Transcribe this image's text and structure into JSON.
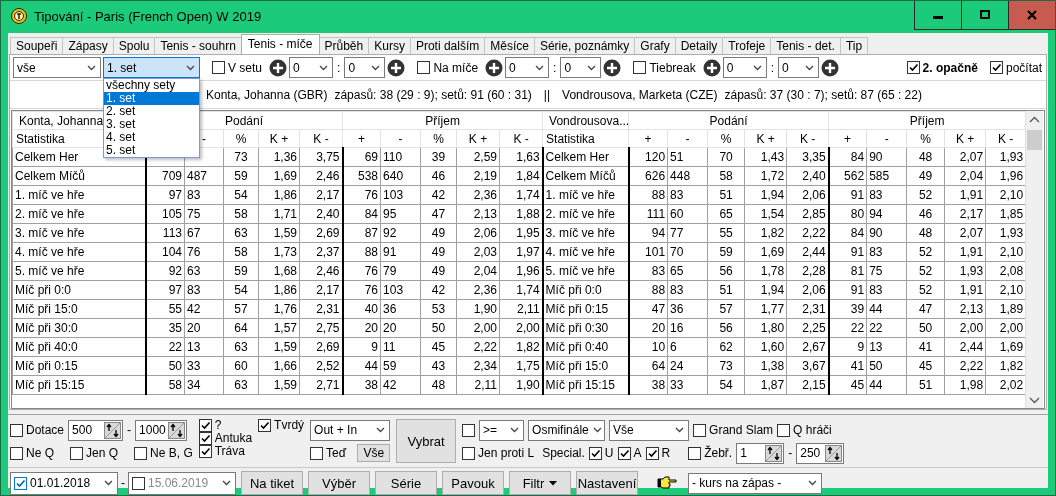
{
  "window": {
    "title": "Tipování - Paris (French Open) W 2019"
  },
  "tabs": [
    {
      "label": "Soupeři",
      "selected": false
    },
    {
      "label": "Zápasy",
      "selected": false
    },
    {
      "label": "Spolu",
      "selected": false
    },
    {
      "label": "Tenis - souhrn",
      "selected": false
    },
    {
      "label": "Tenis - míče",
      "selected": true
    },
    {
      "label": "Průběh",
      "selected": false
    },
    {
      "label": "Kursy",
      "selected": false
    },
    {
      "label": "Proti dalším",
      "selected": false
    },
    {
      "label": "Měsíce",
      "selected": false
    },
    {
      "label": "Série, poznámky",
      "selected": false
    },
    {
      "label": "Grafy",
      "selected": false
    },
    {
      "label": "Detaily",
      "selected": false
    },
    {
      "label": "Trofeje",
      "selected": false
    },
    {
      "label": "Tenis - det.",
      "selected": false
    },
    {
      "label": "Tip",
      "selected": false
    }
  ],
  "filter_bar": {
    "scope": "vše",
    "set_select": {
      "value": "1. set",
      "expanded": true,
      "options": [
        {
          "label": "všechny sety",
          "selected": false
        },
        {
          "label": "1. set",
          "selected": true
        },
        {
          "label": "2. set",
          "selected": false
        },
        {
          "label": "3. set",
          "selected": false
        },
        {
          "label": "4. set",
          "selected": false
        },
        {
          "label": "5. set",
          "selected": false
        }
      ]
    },
    "score_filters": [
      {
        "label": "V setu",
        "checked": false,
        "from": "0",
        "separator": ":",
        "to": "0"
      },
      {
        "label": "Na míče",
        "checked": false,
        "from": "0",
        "separator": ":",
        "to": "0"
      },
      {
        "label": "Tiebreak",
        "checked": false,
        "from": "0",
        "separator": ":",
        "to": "0"
      }
    ],
    "options": [
      {
        "label": "2. opačně",
        "checked": true,
        "bold": true
      },
      {
        "label": "počítat",
        "checked": true,
        "bold": false
      }
    ]
  },
  "match_info": {
    "players": [
      {
        "name": "Konta, Johanna (GBR)",
        "summary": "zápasů: 38 (29 : 9);  setů: 91 (60 : 31)"
      },
      {
        "name": "Vondrousova, Marketa (CZE)",
        "summary": "zápasů: 37 (30 : 7);  setů: 87 (65 : 22)"
      }
    ],
    "separator": "||"
  },
  "stats_table": {
    "panels": [
      {
        "player": "Konta, Johanna",
        "groups": [
          "Podání",
          "Příjem"
        ],
        "columns": [
          {
            "label": "Statistika"
          },
          {},
          {
            "label": "-"
          },
          {
            "label": "%"
          },
          {
            "label": "K +"
          },
          {
            "label": "K -"
          },
          {
            "label": "+"
          },
          {
            "label": "-"
          },
          {
            "label": "%"
          },
          {
            "label": "K +"
          },
          {
            "label": "K -"
          }
        ],
        "rows": [
          [
            "Celkem Her",
            null,
            null,
            "73",
            "1,36",
            "3,75",
            "69",
            "110",
            "39",
            "2,59",
            "1,63"
          ],
          [
            "Celkem Míčů",
            "709",
            "487",
            "59",
            "1,69",
            "2,46",
            "538",
            "640",
            "46",
            "2,19",
            "1,84"
          ],
          [
            "1. míč ve hře",
            "97",
            "83",
            "54",
            "1,86",
            "2,17",
            "76",
            "103",
            "42",
            "2,36",
            "1,74"
          ],
          [
            "2. míč ve hře",
            "105",
            "75",
            "58",
            "1,71",
            "2,40",
            "84",
            "95",
            "47",
            "2,13",
            "1,88"
          ],
          [
            "3. míč ve hře",
            "113",
            "67",
            "63",
            "1,59",
            "2,69",
            "87",
            "92",
            "49",
            "2,06",
            "1,95"
          ],
          [
            "4. míč ve hře",
            "104",
            "76",
            "58",
            "1,73",
            "2,37",
            "88",
            "91",
            "49",
            "2,03",
            "1,97"
          ],
          [
            "5. míč ve hře",
            "92",
            "63",
            "59",
            "1,68",
            "2,46",
            "76",
            "79",
            "49",
            "2,04",
            "1,96"
          ],
          [
            "Míč při 0:0",
            "97",
            "83",
            "54",
            "1,86",
            "2,17",
            "76",
            "103",
            "42",
            "2,36",
            "1,74"
          ],
          [
            "Míč při 15:0",
            "55",
            "42",
            "57",
            "1,76",
            "2,31",
            "40",
            "36",
            "53",
            "1,90",
            "2,11"
          ],
          [
            "Míč při 30:0",
            "35",
            "20",
            "64",
            "1,57",
            "2,75",
            "20",
            "20",
            "50",
            "2,00",
            "2,00"
          ],
          [
            "Míč při 40:0",
            "22",
            "13",
            "63",
            "1,59",
            "2,69",
            "9",
            "11",
            "45",
            "2,22",
            "1,82"
          ],
          [
            "Míč při 0:15",
            "50",
            "33",
            "60",
            "1,66",
            "2,52",
            "44",
            "59",
            "43",
            "2,34",
            "1,75"
          ],
          [
            "Míč při 15:15",
            "58",
            "34",
            "63",
            "1,59",
            "2,71",
            "38",
            "42",
            "48",
            "2,11",
            "1,90"
          ]
        ]
      },
      {
        "player": "Vondrousova...",
        "groups": [
          "Podání",
          "Příjem"
        ],
        "columns": [
          {
            "label": "Statistika"
          },
          {
            "label": "+"
          },
          {
            "label": "-"
          },
          {
            "label": "%"
          },
          {
            "label": "K +"
          },
          {
            "label": "K -"
          },
          {
            "label": "+"
          },
          {
            "label": "-"
          },
          {
            "label": "%"
          },
          {
            "label": "K +"
          },
          {
            "label": "K -"
          }
        ],
        "rows": [
          [
            "Celkem Her",
            "120",
            "51",
            "70",
            "1,43",
            "3,35",
            "84",
            "90",
            "48",
            "2,07",
            "1,93"
          ],
          [
            "Celkem Míčů",
            "626",
            "448",
            "58",
            "1,72",
            "2,40",
            "562",
            "585",
            "49",
            "2,04",
            "1,96"
          ],
          [
            "1. míč ve hře",
            "88",
            "83",
            "51",
            "1,94",
            "2,06",
            "91",
            "83",
            "52",
            "1,91",
            "2,10"
          ],
          [
            "2. míč ve hře",
            "111",
            "60",
            "65",
            "1,54",
            "2,85",
            "80",
            "94",
            "46",
            "2,17",
            "1,85"
          ],
          [
            "3. míč ve hře",
            "94",
            "77",
            "55",
            "1,82",
            "2,22",
            "84",
            "90",
            "48",
            "2,07",
            "1,93"
          ],
          [
            "4. míč ve hře",
            "101",
            "70",
            "59",
            "1,69",
            "2,44",
            "91",
            "83",
            "52",
            "1,91",
            "2,10"
          ],
          [
            "5. míč ve hře",
            "83",
            "65",
            "56",
            "1,78",
            "2,28",
            "81",
            "75",
            "52",
            "1,93",
            "2,08"
          ],
          [
            "Míč při 0:0",
            "88",
            "83",
            "51",
            "1,94",
            "2,06",
            "91",
            "83",
            "52",
            "1,91",
            "2,10"
          ],
          [
            "Míč při 0:15",
            "47",
            "36",
            "57",
            "1,77",
            "2,31",
            "39",
            "44",
            "47",
            "2,13",
            "1,89"
          ],
          [
            "Míč při 0:30",
            "20",
            "16",
            "56",
            "1,80",
            "2,25",
            "22",
            "22",
            "50",
            "2,00",
            "2,00"
          ],
          [
            "Míč při 0:40",
            "10",
            "6",
            "62",
            "1,60",
            "2,67",
            "9",
            "13",
            "41",
            "2,44",
            "1,69"
          ],
          [
            "Míč při 15:0",
            "64",
            "24",
            "73",
            "1,38",
            "3,67",
            "41",
            "50",
            "45",
            "2,22",
            "1,82"
          ],
          [
            "Míč při 15:15",
            "38",
            "33",
            "54",
            "1,87",
            "2,15",
            "45",
            "44",
            "51",
            "1,98",
            "2,02"
          ]
        ]
      }
    ]
  },
  "bottom_filters": {
    "dotace": {
      "label": "Dotace",
      "checked": false,
      "from": "500",
      "separator": "-",
      "to": "1000"
    },
    "qualifier_checks": [
      {
        "label": "Ne Q",
        "checked": false
      },
      {
        "label": "Jen Q",
        "checked": false
      },
      {
        "label": "Ne B, G",
        "checked": false
      }
    ],
    "surfaces": [
      {
        "label": "?",
        "checked": true
      },
      {
        "label": "Antuka",
        "checked": true
      },
      {
        "label": "Tráva",
        "checked": true
      },
      {
        "label": "Tvrdý",
        "checked": true
      }
    ],
    "io_select": "Out + In",
    "now": {
      "label": "Teď",
      "checked": false
    },
    "all_button": "Vše",
    "pick_button": "Vybrat",
    "round": {
      "checked": false,
      "operator": ">=",
      "round": "Osmifinále",
      "category": "Vše"
    },
    "grand_slam": {
      "label": "Grand Slam",
      "checked": false
    },
    "q_players": {
      "label": "Q hráči",
      "checked": false
    },
    "only_left": {
      "label": "Jen proti L",
      "checked": false
    },
    "special": {
      "label": "Special.",
      "flags": [
        {
          "label": "U",
          "checked": true
        },
        {
          "label": "A",
          "checked": true
        },
        {
          "label": "R",
          "checked": true
        }
      ]
    },
    "ranking": {
      "label": "Žebř.",
      "checked": false,
      "from": "1",
      "separator": "-",
      "to": "250"
    }
  },
  "bottom_bar": {
    "date_from": {
      "checked": true,
      "value": "01.01.2018"
    },
    "separator": "-",
    "date_to": {
      "checked": false,
      "value": "15.06.2019"
    },
    "buttons": [
      {
        "label": "Na tiket",
        "kind": "plain"
      },
      {
        "label": "Výběr",
        "kind": "plain"
      },
      {
        "label": "Série",
        "kind": "plain"
      },
      {
        "label": "Pavouk",
        "kind": "plain"
      },
      {
        "label": "Filtr",
        "kind": "menu"
      },
      {
        "label": "Nastavení",
        "kind": "plain"
      }
    ],
    "odds_select": "- kurs na zápas -"
  }
}
